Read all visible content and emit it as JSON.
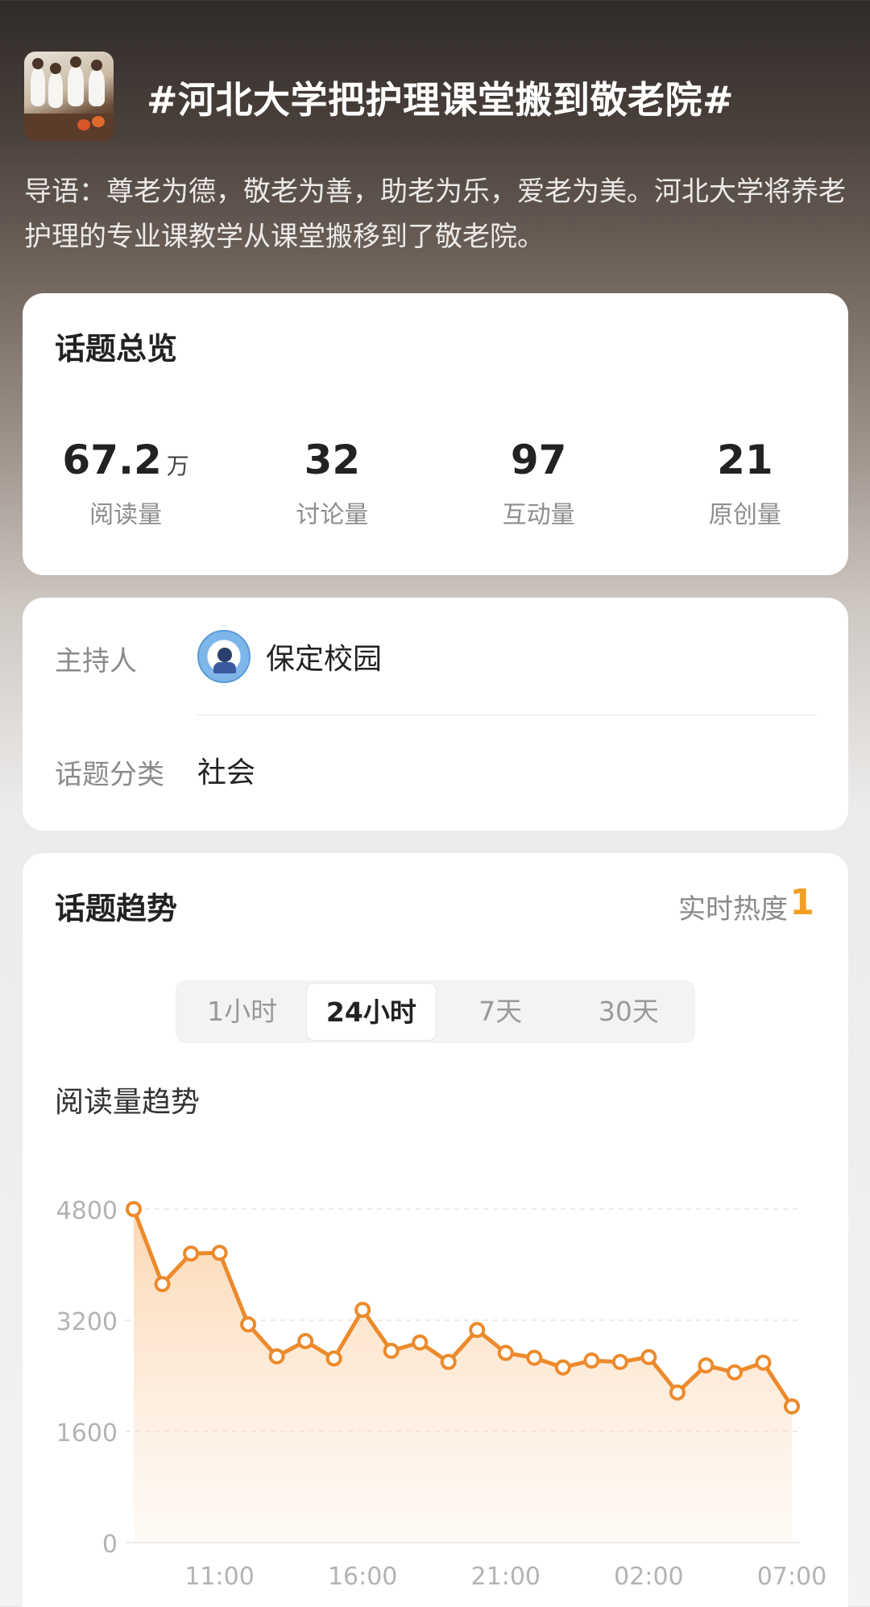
{
  "header": {
    "title": "#河北大学把护理课堂搬到敬老院#",
    "intro": "导语：尊老为德，敬老为善，助老为乐，爱老为美。河北大学将养老护理的专业课教学从课堂搬移到了敬老院。"
  },
  "overview": {
    "title": "话题总览",
    "stats": [
      {
        "value": "67.2",
        "unit": "万",
        "label": "阅读量"
      },
      {
        "value": "32",
        "unit": "",
        "label": "讨论量"
      },
      {
        "value": "97",
        "unit": "",
        "label": "互动量"
      },
      {
        "value": "21",
        "unit": "",
        "label": "原创量"
      }
    ]
  },
  "info": {
    "host_label": "主持人",
    "host_name": "保定校园",
    "category_label": "话题分类",
    "category_value": "社会"
  },
  "trend": {
    "title": "话题趋势",
    "heat_label": "实时热度",
    "heat_value": "1",
    "tabs": [
      "1小时",
      "24小时",
      "7天",
      "30天"
    ],
    "active_tab": "24小时",
    "chart_title": "阅读量趋势"
  },
  "colors": {
    "accent": "#f1a026",
    "line": "#ec8a2c",
    "fill_top": "#fbd5ad"
  },
  "chart_data": {
    "type": "area",
    "title": "阅读量趋势",
    "xlabel": "",
    "ylabel": "",
    "ylim": [
      0,
      4800
    ],
    "yticks": [
      0,
      1600,
      3200,
      4800
    ],
    "xticks": [
      "11:00",
      "16:00",
      "21:00",
      "02:00",
      "07:00"
    ],
    "xtick_index": [
      3,
      8,
      13,
      18,
      23
    ],
    "grid": true,
    "values": [
      4800,
      3720,
      4160,
      4170,
      3140,
      2680,
      2900,
      2650,
      3350,
      2760,
      2880,
      2600,
      3060,
      2730,
      2660,
      2520,
      2620,
      2600,
      2670,
      2160,
      2550,
      2450,
      2590,
      1960
    ]
  }
}
